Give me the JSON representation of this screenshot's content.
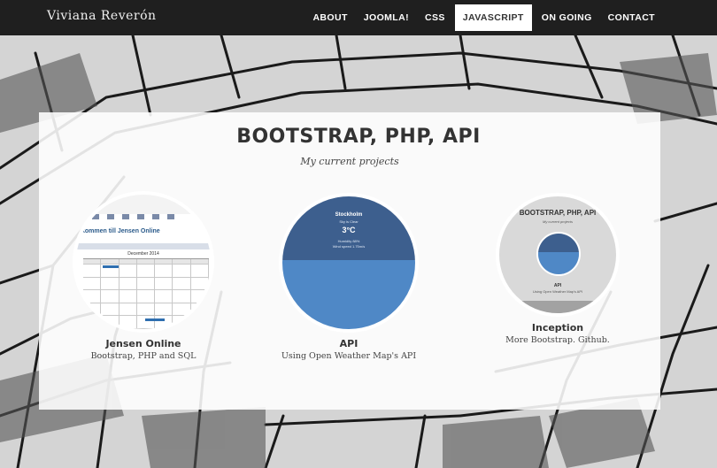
{
  "brand": "Viviana Reverón",
  "nav": {
    "items": [
      "About",
      "Joomla!",
      "CSS",
      "Javascript",
      "On going",
      "Contact"
    ],
    "active_index": 3
  },
  "hero": {
    "title": "BOOTSTRAP, PHP, API",
    "subtitle": "My current projects"
  },
  "projects": [
    {
      "title": "Jensen Online",
      "description": "Bootstrap, PHP and SQL",
      "thumbnail": {
        "welcome": "kommen till Jensen Online",
        "month": "December 2014"
      }
    },
    {
      "title": "API",
      "description": "Using Open Weather Map's API",
      "thumbnail": {
        "city": "Stockholm",
        "sub": "Sky is Clear",
        "temp": "3°C",
        "humidity": "Humidity 88%",
        "wind": "Wind speed 1.75m/s"
      }
    },
    {
      "title": "Inception",
      "description": "More Bootstrap. Github.",
      "thumbnail": {
        "title": "BOOTSTRAP, PHP, API",
        "sub": "My current projects",
        "caption": "API",
        "caption_sub": "Using Open Weather Map's API"
      }
    }
  ],
  "colors": {
    "navbar": "#1f1f1f",
    "accent_blue": "#4f88c6",
    "dark_blue": "#3d5f8e"
  }
}
